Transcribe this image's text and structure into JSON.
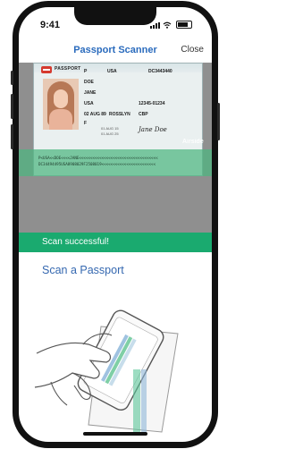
{
  "status_bar": {
    "time": "9:41"
  },
  "nav": {
    "title": "Passport Scanner",
    "close_label": "Close"
  },
  "camera": {
    "passport": {
      "header_label": "PASSPORT",
      "type_value": "P",
      "country_value": "USA",
      "passport_no": "DC3443440",
      "surname": "DOE",
      "given_names": "JANE",
      "nationality": "USA",
      "personal_no": "12345-01234",
      "dob": "02 AUG 89",
      "place_of_birth": "ROSSLYN",
      "authority": "CBP",
      "sex": "F",
      "date_of_issue": "01 AUG 15",
      "date_of_expiry": "01 AUG 25",
      "signature": "Jane Doe"
    },
    "mrz_line_1": "P<USA<<DOE<<<<JANE<<<<<<<<<<<<<<<<<<<<<<<<<<<<<<<<<<<",
    "mrz_line_2": "DC34494495USA8908029F2508019<<<<<<<<<<<<<<<<<<<<<<<<",
    "watermark": "Airside"
  },
  "status_banner": {
    "text": "Scan successful!",
    "color": "#1aaa6f"
  },
  "instruction": {
    "text": "Scan a Passport",
    "color": "#3568b0"
  },
  "illustration": {
    "icon": "hand-holding-phone-scanning-passport-illustration"
  }
}
